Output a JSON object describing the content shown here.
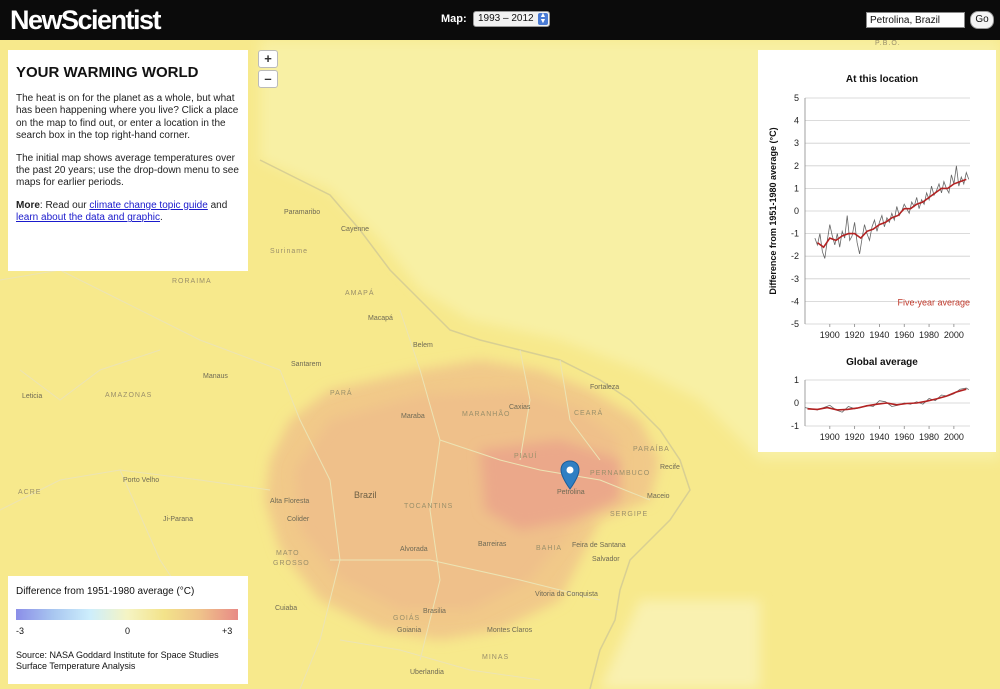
{
  "header": {
    "logo": "NewScientist",
    "map_label": "Map:",
    "map_selected": "1993 – 2012",
    "search_value": "Petrolina, Brazil",
    "go_label": "Go"
  },
  "zoom": {
    "in_label": "+",
    "out_label": "–"
  },
  "intro": {
    "title": "YOUR WARMING WORLD",
    "para1": "The heat is on for the planet as a whole, but what has been happening where you live? Click a place on the map to find out, or enter a location in the search box in the top right-hand corner.",
    "para2": "The initial map shows average temperatures over the past 20 years; use the drop-down menu to see maps for earlier periods.",
    "more_label": "More",
    "more_sep": ": Read our ",
    "link1": "climate change topic guide",
    "and_text": " and ",
    "link2": "learn about the data and graphic",
    "end": "."
  },
  "legend": {
    "title": "Difference from 1951-1980 average (°C)",
    "min_label": "-3",
    "mid_label": "0",
    "max_label": "+3",
    "source": "Source: NASA Goddard Institute for Space Studies Surface Temperature Analysis"
  },
  "map_labels": [
    {
      "id": "paramaribo",
      "text": "Paramaribo"
    },
    {
      "id": "cayenne",
      "text": "Cayenne"
    },
    {
      "id": "suriname",
      "text": "Suriname"
    },
    {
      "id": "roraima",
      "text": "RORAIMA"
    },
    {
      "id": "amapa",
      "text": "AMAPÁ"
    },
    {
      "id": "macapa",
      "text": "Macapá"
    },
    {
      "id": "belem",
      "text": "Belem"
    },
    {
      "id": "santarem",
      "text": "Santarem"
    },
    {
      "id": "manaus",
      "text": "Manaus"
    },
    {
      "id": "amazonas",
      "text": "AMAZONAS"
    },
    {
      "id": "leticia",
      "text": "Leticia"
    },
    {
      "id": "para",
      "text": "PARÁ"
    },
    {
      "id": "maraba",
      "text": "Maraba"
    },
    {
      "id": "maranhao",
      "text": "MARANHÃO"
    },
    {
      "id": "caxias",
      "text": "Caxias"
    },
    {
      "id": "fortaleza",
      "text": "Fortaleza"
    },
    {
      "id": "ceara",
      "text": "CEARÁ"
    },
    {
      "id": "paraiba",
      "text": "PARAÍBA"
    },
    {
      "id": "recife",
      "text": "Recife"
    },
    {
      "id": "piaui",
      "text": "PIAUÍ"
    },
    {
      "id": "pernambuco",
      "text": "PERNAMBUCO"
    },
    {
      "id": "maceio",
      "text": "Maceio"
    },
    {
      "id": "petrolina",
      "text": "Petrolina"
    },
    {
      "id": "sergipe",
      "text": "SERGIPE"
    },
    {
      "id": "portovelho",
      "text": "Porto Velho"
    },
    {
      "id": "altafloresta",
      "text": "Alta Floresta"
    },
    {
      "id": "colider",
      "text": "Colider"
    },
    {
      "id": "brazil",
      "text": "Brazil"
    },
    {
      "id": "tocantins",
      "text": "TOCANTINS"
    },
    {
      "id": "jiparana",
      "text": "Ji-Parana"
    },
    {
      "id": "barreiras",
      "text": "Barreiras"
    },
    {
      "id": "bahia",
      "text": "BAHIA"
    },
    {
      "id": "feira",
      "text": "Feira de Santana"
    },
    {
      "id": "salvador",
      "text": "Salvador"
    },
    {
      "id": "alvorada",
      "text": "Alvorada"
    },
    {
      "id": "matogrosso1",
      "text": "MATO"
    },
    {
      "id": "matogrosso2",
      "text": "GROSSO"
    },
    {
      "id": "vitoria",
      "text": "Vitoria da Conquista"
    },
    {
      "id": "cuiaba",
      "text": "Cuiaba"
    },
    {
      "id": "brasilia",
      "text": "Brasilia"
    },
    {
      "id": "goias",
      "text": "GOIÁS"
    },
    {
      "id": "goiania",
      "text": "Goiania"
    },
    {
      "id": "montesclaros",
      "text": "Montes Claros"
    },
    {
      "id": "uberlandia",
      "text": "Uberlandia"
    },
    {
      "id": "minas",
      "text": "MINAS"
    },
    {
      "id": "pbo",
      "text": "P.B.O."
    },
    {
      "id": "acre",
      "text": "ACRE"
    }
  ],
  "colors": {
    "series_line": "#333333",
    "average_line": "#b22222",
    "average_label": "#c0392b"
  },
  "chart_data": [
    {
      "type": "line",
      "title": "At this location",
      "ylabel": "Difference from 1951-1980 average (°C)",
      "xlabel": "",
      "xlim": [
        1880,
        2013
      ],
      "ylim": [
        -5,
        5
      ],
      "xticks": [
        "1900",
        "1920",
        "1940",
        "1960",
        "1980",
        "2000"
      ],
      "yticks": [
        "5",
        "4",
        "3",
        "2",
        "1",
        "0",
        "-1",
        "-2",
        "-3",
        "-4",
        "-5"
      ],
      "annotation": "Five-year average",
      "grid": true,
      "series": [
        {
          "name": "annual",
          "x": [
            1888,
            1890,
            1892,
            1894,
            1896,
            1898,
            1900,
            1902,
            1904,
            1906,
            1908,
            1910,
            1912,
            1914,
            1916,
            1918,
            1920,
            1922,
            1924,
            1926,
            1928,
            1930,
            1932,
            1934,
            1936,
            1938,
            1940,
            1942,
            1944,
            1946,
            1948,
            1950,
            1952,
            1954,
            1956,
            1958,
            1960,
            1962,
            1964,
            1966,
            1968,
            1970,
            1972,
            1974,
            1976,
            1978,
            1980,
            1982,
            1984,
            1986,
            1988,
            1990,
            1992,
            1994,
            1996,
            1998,
            2000,
            2002,
            2004,
            2006,
            2008,
            2010,
            2012
          ],
          "y": [
            -1.2,
            -1.5,
            -1.0,
            -1.8,
            -2.1,
            -1.3,
            -0.6,
            -1.1,
            -1.5,
            -1.0,
            -1.6,
            -0.9,
            -1.2,
            -0.2,
            -1.3,
            -1.1,
            -0.5,
            -1.4,
            -1.9,
            -1.2,
            -0.6,
            -1.0,
            -1.3,
            -0.7,
            -0.4,
            -0.9,
            -0.5,
            -0.2,
            -0.7,
            -0.3,
            -0.5,
            -0.1,
            -0.4,
            0.2,
            -0.2,
            0.0,
            0.3,
            0.1,
            -0.1,
            0.4,
            0.2,
            0.6,
            0.1,
            0.5,
            0.3,
            0.8,
            0.5,
            1.1,
            0.7,
            0.9,
            1.2,
            0.8,
            1.3,
            1.0,
            0.8,
            1.6,
            1.2,
            2.0,
            1.1,
            1.5,
            1.2,
            1.7,
            1.4
          ]
        },
        {
          "name": "Five-year average",
          "x": [
            1890,
            1895,
            1900,
            1905,
            1910,
            1915,
            1920,
            1925,
            1930,
            1935,
            1940,
            1945,
            1950,
            1955,
            1960,
            1965,
            1970,
            1975,
            1980,
            1985,
            1990,
            1995,
            2000,
            2005,
            2010
          ],
          "y": [
            -1.4,
            -1.6,
            -1.2,
            -1.3,
            -1.1,
            -1.0,
            -1.0,
            -1.2,
            -0.9,
            -0.8,
            -0.6,
            -0.5,
            -0.3,
            -0.2,
            0.1,
            0.1,
            0.3,
            0.4,
            0.6,
            0.8,
            1.0,
            1.0,
            1.2,
            1.3,
            1.4
          ]
        }
      ]
    },
    {
      "type": "line",
      "title": "Global average",
      "xlim": [
        1880,
        2013
      ],
      "ylim": [
        -1,
        1
      ],
      "xticks": [
        "1900",
        "1920",
        "1940",
        "1960",
        "1980",
        "2000"
      ],
      "yticks": [
        "1",
        "0",
        "-1"
      ],
      "grid": true,
      "series": [
        {
          "name": "annual",
          "x": [
            1880,
            1885,
            1890,
            1895,
            1900,
            1905,
            1910,
            1915,
            1920,
            1925,
            1930,
            1935,
            1940,
            1945,
            1950,
            1955,
            1960,
            1965,
            1970,
            1975,
            1980,
            1985,
            1990,
            1995,
            2000,
            2005,
            2010,
            2012
          ],
          "y": [
            -0.2,
            -0.25,
            -0.3,
            -0.2,
            -0.1,
            -0.3,
            -0.4,
            -0.15,
            -0.25,
            -0.2,
            -0.1,
            -0.15,
            0.1,
            0.05,
            -0.15,
            -0.1,
            0.0,
            -0.05,
            0.05,
            -0.05,
            0.2,
            0.1,
            0.35,
            0.3,
            0.4,
            0.6,
            0.65,
            0.58
          ]
        },
        {
          "name": "Five-year average",
          "x": [
            1882,
            1890,
            1898,
            1906,
            1914,
            1922,
            1930,
            1938,
            1946,
            1954,
            1962,
            1970,
            1978,
            1986,
            1994,
            2002,
            2010
          ],
          "y": [
            -0.25,
            -0.28,
            -0.2,
            -0.3,
            -0.28,
            -0.22,
            -0.12,
            -0.05,
            0.0,
            -0.08,
            -0.02,
            0.0,
            0.08,
            0.18,
            0.3,
            0.48,
            0.6
          ]
        }
      ]
    }
  ]
}
